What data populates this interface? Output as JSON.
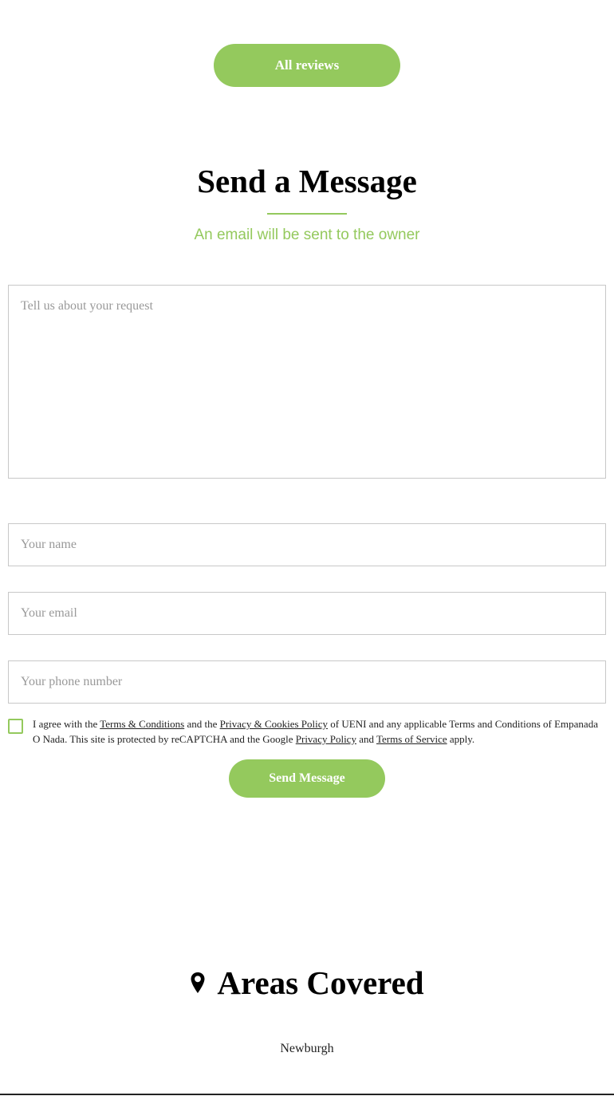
{
  "reviews": {
    "all_reviews_label": "All reviews"
  },
  "message_section": {
    "title": "Send a Message",
    "subtitle": "An email will be sent to the owner",
    "request_placeholder": "Tell us about your request",
    "name_placeholder": "Your name",
    "email_placeholder": "Your email",
    "phone_placeholder": "Your phone number",
    "consent": {
      "text_1": "I agree with the ",
      "terms_link": "Terms & Conditions",
      "text_2": " and the ",
      "privacy_cookies_link": "Privacy & Cookies Policy",
      "text_3": " of UENI and any applicable Terms and Conditions of Empanada O Nada. This site is protected by reCAPTCHA and the Google ",
      "google_privacy_link": "Privacy Policy",
      "text_4": " and ",
      "google_terms_link": "Terms of Service",
      "text_5": " apply."
    },
    "send_label": "Send Message"
  },
  "areas_section": {
    "title": "Areas Covered",
    "icon": "map-pin-icon",
    "items": [
      "Newburgh"
    ]
  },
  "colors": {
    "accent": "#94c95d",
    "text": "#222222",
    "border": "#c8c8c8"
  }
}
